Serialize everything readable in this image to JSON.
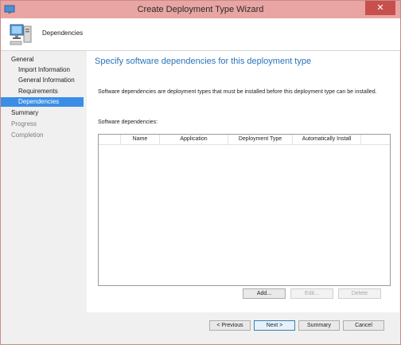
{
  "window": {
    "title": "Create Deployment Type Wizard",
    "close_glyph": "✕"
  },
  "header": {
    "title": "Dependencies",
    "icon": "computer-icon"
  },
  "nav": {
    "items": [
      {
        "label": "General",
        "level": "top",
        "state": "normal"
      },
      {
        "label": "Import Information",
        "level": "sub",
        "state": "normal"
      },
      {
        "label": "General Information",
        "level": "sub",
        "state": "normal"
      },
      {
        "label": "Requirements",
        "level": "sub",
        "state": "normal"
      },
      {
        "label": "Dependencies",
        "level": "sub",
        "state": "active"
      },
      {
        "label": "Summary",
        "level": "top",
        "state": "normal"
      },
      {
        "label": "Progress",
        "level": "top",
        "state": "dim"
      },
      {
        "label": "Completion",
        "level": "top",
        "state": "dim"
      }
    ]
  },
  "main": {
    "heading": "Specify software dependencies for this deployment type",
    "description": "Software dependencies are deployment types that must be installed before this deployment type can be installed.",
    "list_label": "Software dependencies:",
    "columns": [
      "Name",
      "Application",
      "Deployment Type",
      "Automatically Install"
    ],
    "rows": []
  },
  "list_buttons": {
    "add": "Add...",
    "edit": "Edit...",
    "delete": "Delete"
  },
  "footer": {
    "previous": "< Previous",
    "next": "Next >",
    "summary": "Summary",
    "cancel": "Cancel"
  },
  "colors": {
    "titlebar": "#e8a5a3",
    "accent": "#3a8ee6",
    "heading": "#2a74b8"
  }
}
